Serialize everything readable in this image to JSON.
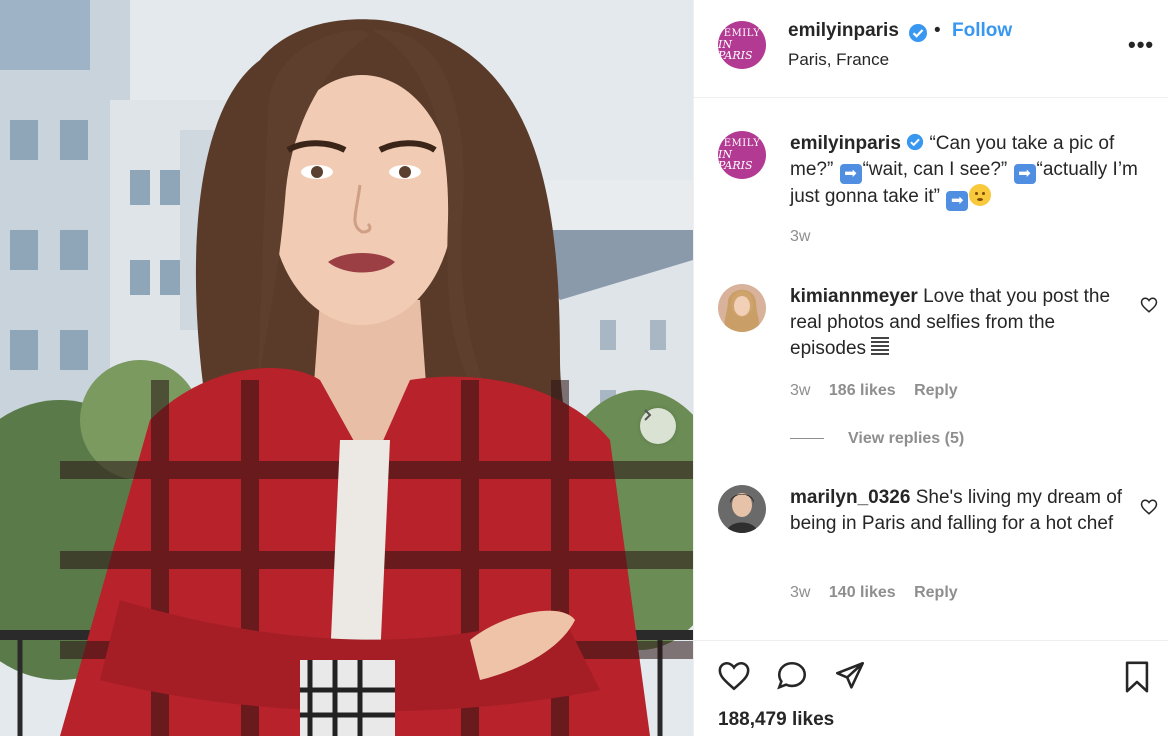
{
  "post": {
    "username": "emilyinparis",
    "separator": "•",
    "follow_label": "Follow",
    "location": "Paris, France",
    "more_label": "•••",
    "avatar_text_line1": "EMILY",
    "avatar_text_line2": "IN PARIS"
  },
  "caption": {
    "username": "emilyinparis",
    "part1": " “Can you take a pic of me?” ",
    "part2": "“wait, can I see?” ",
    "part3": "“actually I’m just gonna take it” ",
    "arrow_emoji": "➡",
    "time": "3w"
  },
  "comments": [
    {
      "username": "kimiannmeyer",
      "text": " Love that you post the real photos and selfies from the episodes ",
      "time": "3w",
      "likes": "186 likes",
      "reply": "Reply"
    },
    {
      "username": "marilyn_0326",
      "text": " She's living my dream of being in Paris and falling for a hot chef",
      "time": "3w",
      "likes": "140 likes",
      "reply": "Reply"
    }
  ],
  "view_replies": "View replies (5)",
  "likes_count": "188,479 likes",
  "colors": {
    "link_blue": "#3897f0",
    "brand_magenta": "#b23a92",
    "muted_gray": "#8e8e8e",
    "text": "#262626"
  },
  "icons": [
    "verified-badge-icon",
    "more-options-icon",
    "chevron-right-icon",
    "heart-icon",
    "comment-icon",
    "share-icon",
    "bookmark-icon"
  ]
}
